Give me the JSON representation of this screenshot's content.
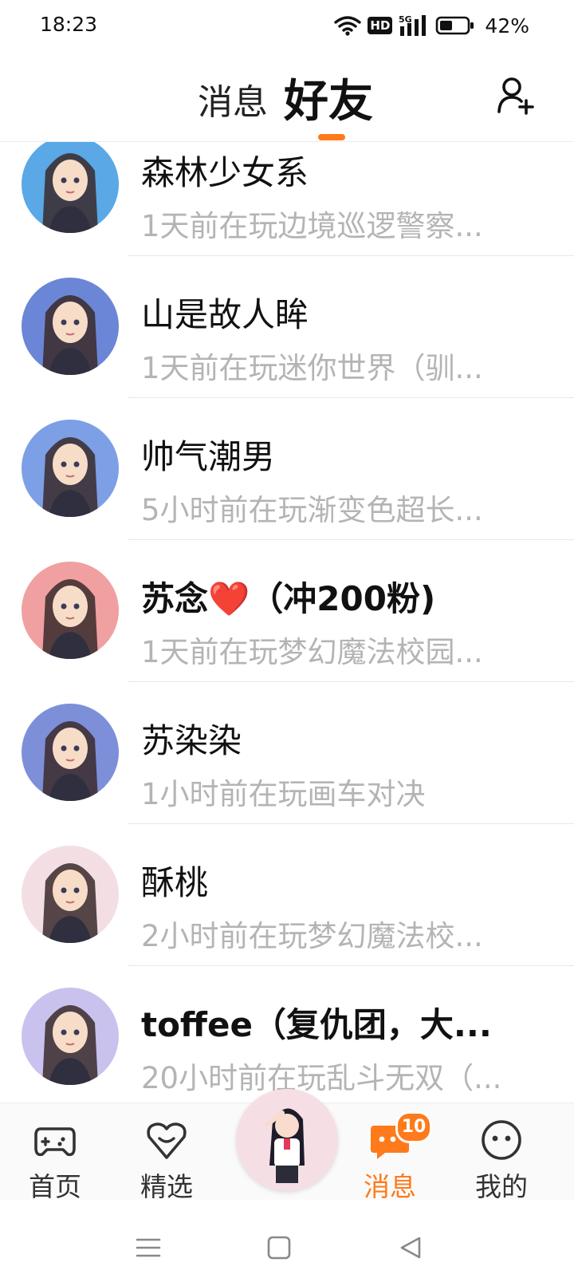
{
  "status_bar": {
    "time": "18:23",
    "battery_pct": "42%",
    "network": "5G",
    "hd": "HD"
  },
  "header": {
    "tab_messages": "消息",
    "tab_friends": "好友"
  },
  "friends": [
    {
      "name": "森林少女系",
      "activity": "1天前在玩边境巡逻警察...",
      "bold": false,
      "palette": "#5aa8e6"
    },
    {
      "name": "山是故人眸",
      "activity": "1天前在玩迷你世界（驯...",
      "bold": false,
      "palette": "#6b86d6"
    },
    {
      "name": "帅气潮男",
      "activity": "5小时前在玩渐变色超长...",
      "bold": false,
      "palette": "#7c9fe6"
    },
    {
      "name": "苏念❤️（冲200粉)",
      "activity": "1天前在玩梦幻魔法校园...",
      "bold": true,
      "palette": "#f0a0a0"
    },
    {
      "name": "苏染染",
      "activity": "1小时前在玩画车对决",
      "bold": false,
      "palette": "#7e8fd9"
    },
    {
      "name": "酥桃",
      "activity": "2小时前在玩梦幻魔法校...",
      "bold": false,
      "palette": "#f3dfe3"
    },
    {
      "name": "toffee（复仇团，大...",
      "activity": "20小时前在玩乱斗无双（...",
      "bold": true,
      "palette": "#c9c2ef"
    }
  ],
  "nav": {
    "home": "首页",
    "featured": "精选",
    "messages": "消息",
    "messages_badge": "10",
    "mine": "我的"
  },
  "colors": {
    "accent": "#ff7a1a",
    "secondary_text": "#b4b4b4"
  }
}
